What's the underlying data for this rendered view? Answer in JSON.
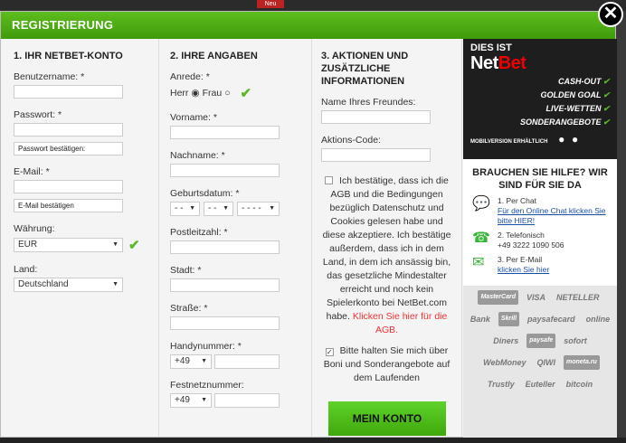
{
  "background": {
    "menu_label": "Neu"
  },
  "header": {
    "title": "REGISTRIERUNG",
    "close_symbol": "✕"
  },
  "col1": {
    "title": "1. IHR NETBET-KONTO",
    "username_label": "Benutzername: *",
    "password_label": "Passwort: *",
    "password_confirm_placeholder": "Passwort bestätigen:",
    "email_label": "E-Mail: *",
    "email_confirm_placeholder": "E-Mail bestätigen",
    "currency_label": "Währung:",
    "currency_value": "EUR",
    "country_label": "Land:",
    "country_value": "Deutschland"
  },
  "col2": {
    "title": "2. IHRE ANGABEN",
    "salutation_label": "Anrede: *",
    "salutation_options": [
      "Herr",
      "Frau"
    ],
    "first_name_label": "Vorname: *",
    "last_name_label": "Nachname: *",
    "dob_label": "Geburtsdatum: *",
    "dob_day": "- -",
    "dob_month": "- -",
    "dob_year": "- - - -",
    "postcode_label": "Postleitzahl: *",
    "city_label": "Stadt: *",
    "street_label": "Straße: *",
    "mobile_label": "Handynummer: *",
    "mobile_prefix": "+49",
    "landline_label": "Festnetznummer:",
    "landline_prefix": "+49"
  },
  "col3": {
    "title": "3. AKTIONEN UND ZUSÄTZLICHE INFORMATIONEN",
    "friend_label": "Name Ihres Freundes:",
    "promo_label": "Aktions-Code:",
    "terms_text": "Ich bestätige, dass ich die AGB und die Bedingungen bezüglich Datenschutz und Cookies gelesen habe und diese akzeptiere. Ich bestätige außerdem, dass ich in dem Land, in dem ich ansässig bin, das gesetzliche Mindestalter erreicht und noch kein Spielerkonto bei NetBet.com habe.",
    "terms_link": "Klicken Sie hier für die AGB.",
    "newsletter_text": "Bitte halten Sie mich über Boni und Sonderangebote auf dem Laufenden",
    "submit_label": "MEIN KONTO ERSTELLEN"
  },
  "promo": {
    "dies_ist": "DIES IST",
    "logo_net": "Net",
    "logo_bet": "Bet",
    "features": [
      "CASH-OUT",
      "GOLDEN GOAL",
      "LIVE-WETTEN",
      "SONDERANGEBOTE"
    ],
    "mobile_text": "MOBILVERSION ERHÄLTLICH"
  },
  "help": {
    "title": "BRAUCHEN SIE HILFE? WIR SIND FÜR SIE DA",
    "chat_title": "1. Per Chat",
    "chat_link": "Für den Online Chat klicken Sie bitte HIER!",
    "phone_title": "2. Telefonisch",
    "phone_number": "+49 3222 1090 506",
    "email_title": "3. Per E-Mail",
    "email_link": "klicken Sie hier"
  },
  "payments": [
    "MasterCard",
    "VISA",
    "NETELLER",
    "Bank",
    "Skrill",
    "paysafecard",
    "online",
    "Diners",
    "paysafe",
    "sofort",
    "WebMoney",
    "QIWI",
    "moneta.ru",
    "Trustly",
    "Euteller",
    "bitcoin"
  ]
}
